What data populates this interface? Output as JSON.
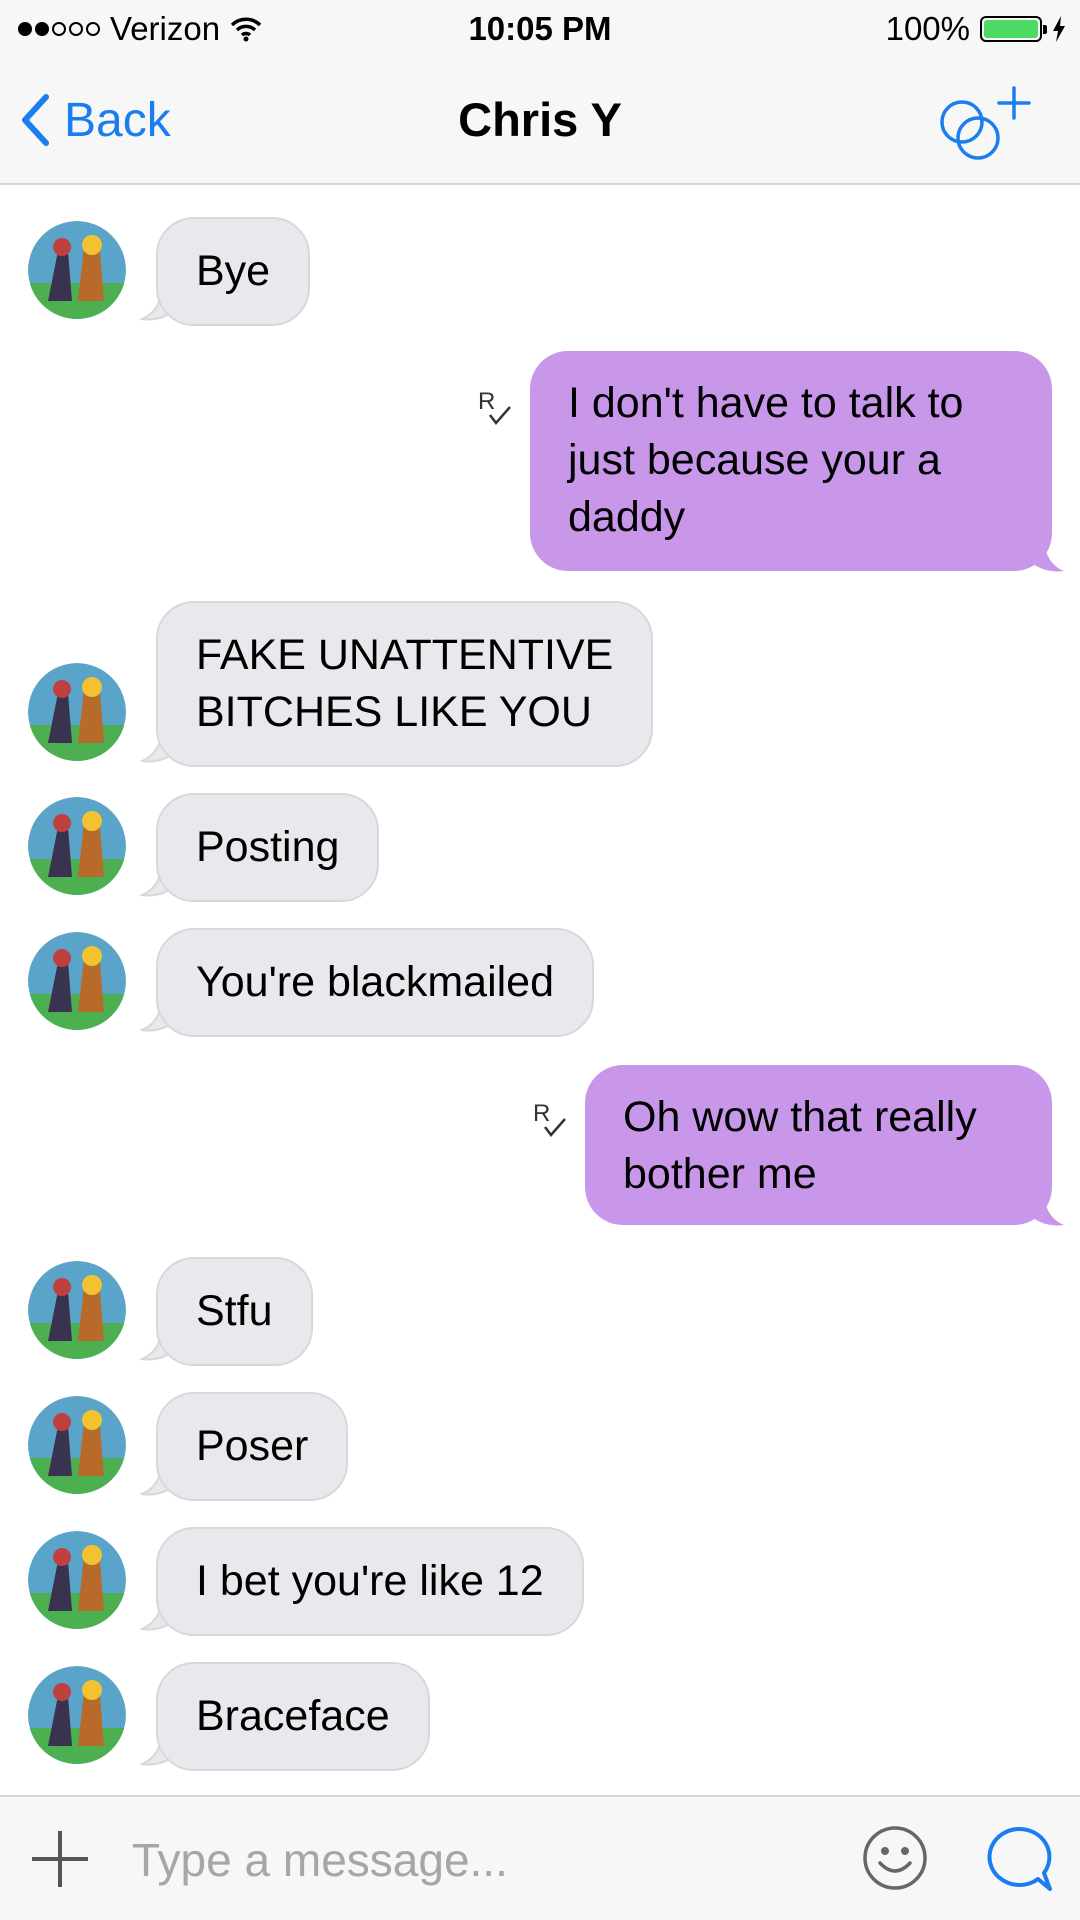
{
  "status_bar": {
    "carrier": "Verizon",
    "signal_bars_filled": 2,
    "signal_bars_total": 5,
    "time": "10:05 PM",
    "battery": "100%",
    "battery_level": 1.0,
    "charging": true
  },
  "nav": {
    "back_label": "Back",
    "title": "Chris Y",
    "accent_color": "#1a7ef0"
  },
  "messages": [
    {
      "direction": "in",
      "text": "Bye"
    },
    {
      "direction": "out",
      "text": "I don't have to talk to\njust because your a\ndaddy",
      "read": true
    },
    {
      "direction": "in",
      "text": "FAKE UNATTENTIVE\nBITCHES LIKE YOU"
    },
    {
      "direction": "in",
      "text": "Posting"
    },
    {
      "direction": "in",
      "text": "You're blackmailed"
    },
    {
      "direction": "out",
      "text": "Oh wow that really\nbother me",
      "read": true
    },
    {
      "direction": "in",
      "text": "Stfu"
    },
    {
      "direction": "in",
      "text": "Poser"
    },
    {
      "direction": "in",
      "text": "I bet you're like 12"
    },
    {
      "direction": "in",
      "text": "Braceface"
    }
  ],
  "colors": {
    "incoming_bubble": "#e8e9ec",
    "outgoing_bubble": "#c897e9"
  },
  "composer": {
    "placeholder": "Type a message...",
    "value": ""
  },
  "icons": {
    "back": "chevron-left-icon",
    "add_contact": "add-participant-icon",
    "attach": "plus-icon",
    "emoji": "smiley-icon",
    "send": "chat-bubble-icon",
    "read_receipt": "read-receipt-icon"
  }
}
